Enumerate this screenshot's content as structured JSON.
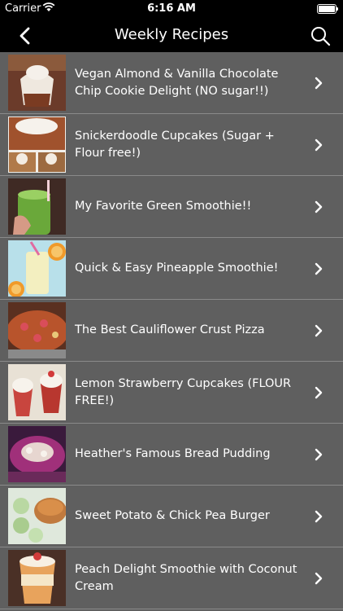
{
  "status_bar": {
    "carrier": "Carrier",
    "time": "6:16 AM"
  },
  "nav": {
    "title": "Weekly Recipes",
    "back_icon": "chevron-left-icon",
    "search_icon": "search-icon"
  },
  "recipes": [
    {
      "label": "Vegan Almond & Vanilla Chocolate Chip Cookie Delight (NO sugar!!)"
    },
    {
      "label": "Snickerdoodle Cupcakes (Sugar + Flour free!)"
    },
    {
      "label": "My Favorite Green Smoothie!!"
    },
    {
      "label": "Quick & Easy Pineapple Smoothie!"
    },
    {
      "label": "The Best Cauliflower Crust Pizza"
    },
    {
      "label": "Lemon Strawberry Cupcakes (FLOUR FREE!)"
    },
    {
      "label": "Heather's Famous Bread Pudding"
    },
    {
      "label": "Sweet Potato & Chick Pea Burger"
    },
    {
      "label": "Peach Delight Smoothie with Coconut Cream"
    }
  ]
}
